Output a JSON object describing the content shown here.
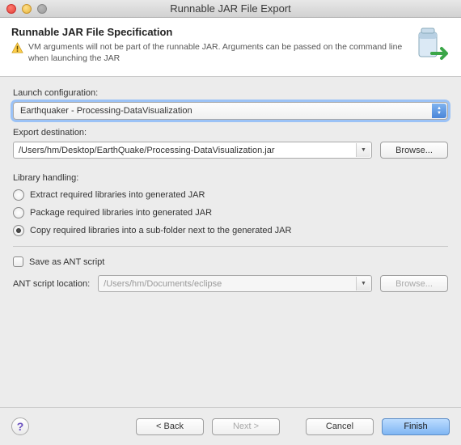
{
  "window": {
    "title": "Runnable JAR File Export"
  },
  "header": {
    "heading": "Runnable JAR File Specification",
    "warning": "VM arguments will not be part of the runnable JAR. Arguments can be passed on the command line when launching the JAR"
  },
  "launch": {
    "label": "Launch configuration:",
    "value": "Earthquaker - Processing-DataVisualization"
  },
  "export": {
    "label": "Export destination:",
    "value": "/Users/hm/Desktop/EarthQuake/Processing-DataVisualization.jar",
    "browse": "Browse..."
  },
  "library": {
    "label": "Library handling:",
    "options": [
      "Extract required libraries into generated JAR",
      "Package required libraries into generated JAR",
      "Copy required libraries into a sub-folder next to the generated JAR"
    ],
    "selected": 2
  },
  "ant": {
    "checkbox_label": "Save as ANT script",
    "location_label": "ANT script location:",
    "location_value": "/Users/hm/Documents/eclipse",
    "browse": "Browse..."
  },
  "footer": {
    "back": "< Back",
    "next": "Next >",
    "cancel": "Cancel",
    "finish": "Finish"
  }
}
